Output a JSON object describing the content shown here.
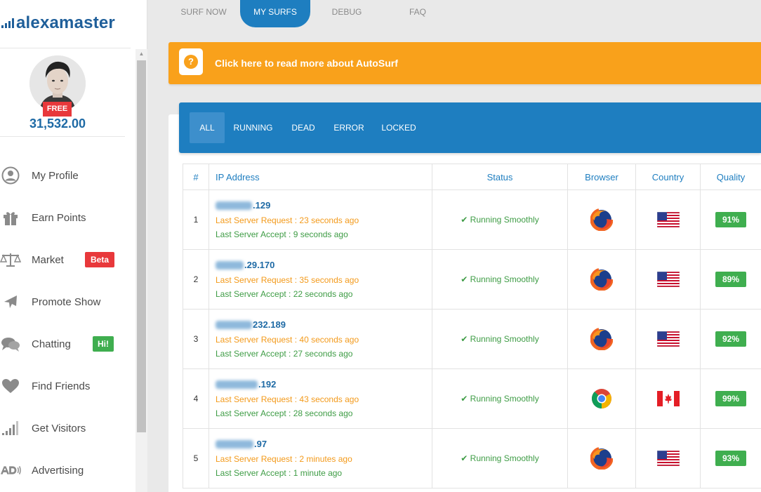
{
  "sidebar": {
    "logo": "alexamaster",
    "account_badge": "FREE",
    "points": "31,532.00",
    "items": [
      {
        "label": "My Profile",
        "icon": "user-icon"
      },
      {
        "label": "Earn Points",
        "icon": "gift-icon"
      },
      {
        "label": "Market",
        "icon": "scale-icon",
        "pill": "Beta",
        "pill_color": "#e8383b"
      },
      {
        "label": "Promote Show",
        "icon": "plane-icon"
      },
      {
        "label": "Chatting",
        "icon": "chat-icon",
        "pill": "Hi!",
        "pill_color": "#3fae4f"
      },
      {
        "label": "Find Friends",
        "icon": "heart-icon"
      },
      {
        "label": "Get Visitors",
        "icon": "signal-bars-icon"
      },
      {
        "label": "Advertising",
        "icon": "ad-icon"
      }
    ]
  },
  "top_tabs": [
    {
      "label": "SURF NOW",
      "active": false
    },
    {
      "label": "MY SURFS",
      "active": true
    },
    {
      "label": "DEBUG",
      "active": false
    },
    {
      "label": "FAQ",
      "active": false
    }
  ],
  "banner": {
    "icon": "question-icon",
    "text": "Click here to read more about AutoSurf",
    "color": "#f9a11b"
  },
  "filters": [
    {
      "label": "ALL",
      "active": true
    },
    {
      "label": "RUNNING",
      "active": false
    },
    {
      "label": "DEAD",
      "active": false
    },
    {
      "label": "ERROR",
      "active": false
    },
    {
      "label": "LOCKED",
      "active": false
    }
  ],
  "table": {
    "headers": [
      "#",
      "IP Address",
      "Status",
      "Browser",
      "Country",
      "Quality"
    ],
    "rows": [
      {
        "num": "1",
        "ip_visible": ".129",
        "last_request": "Last Server Request : 23 seconds ago",
        "last_accept": "Last Server Accept : 9 seconds ago",
        "status": "Running Smoothly",
        "browser": "firefox",
        "country": "us",
        "quality": "91%"
      },
      {
        "num": "2",
        "ip_visible": ".29.170",
        "last_request": "Last Server Request : 35 seconds ago",
        "last_accept": "Last Server Accept : 22 seconds ago",
        "status": "Running Smoothly",
        "browser": "firefox",
        "country": "us",
        "quality": "89%"
      },
      {
        "num": "3",
        "ip_visible": "232.189",
        "last_request": "Last Server Request : 40 seconds ago",
        "last_accept": "Last Server Accept : 27 seconds ago",
        "status": "Running Smoothly",
        "browser": "firefox",
        "country": "us",
        "quality": "92%"
      },
      {
        "num": "4",
        "ip_visible": ".192",
        "last_request": "Last Server Request : 43 seconds ago",
        "last_accept": "Last Server Accept : 28 seconds ago",
        "status": "Running Smoothly",
        "browser": "chrome",
        "country": "ca",
        "quality": "99%"
      },
      {
        "num": "5",
        "ip_visible": ".97",
        "last_request": "Last Server Request : 2 minutes ago",
        "last_accept": "Last Server Accept : 1 minute ago",
        "status": "Running Smoothly",
        "browser": "firefox",
        "country": "us",
        "quality": "93%"
      }
    ]
  }
}
